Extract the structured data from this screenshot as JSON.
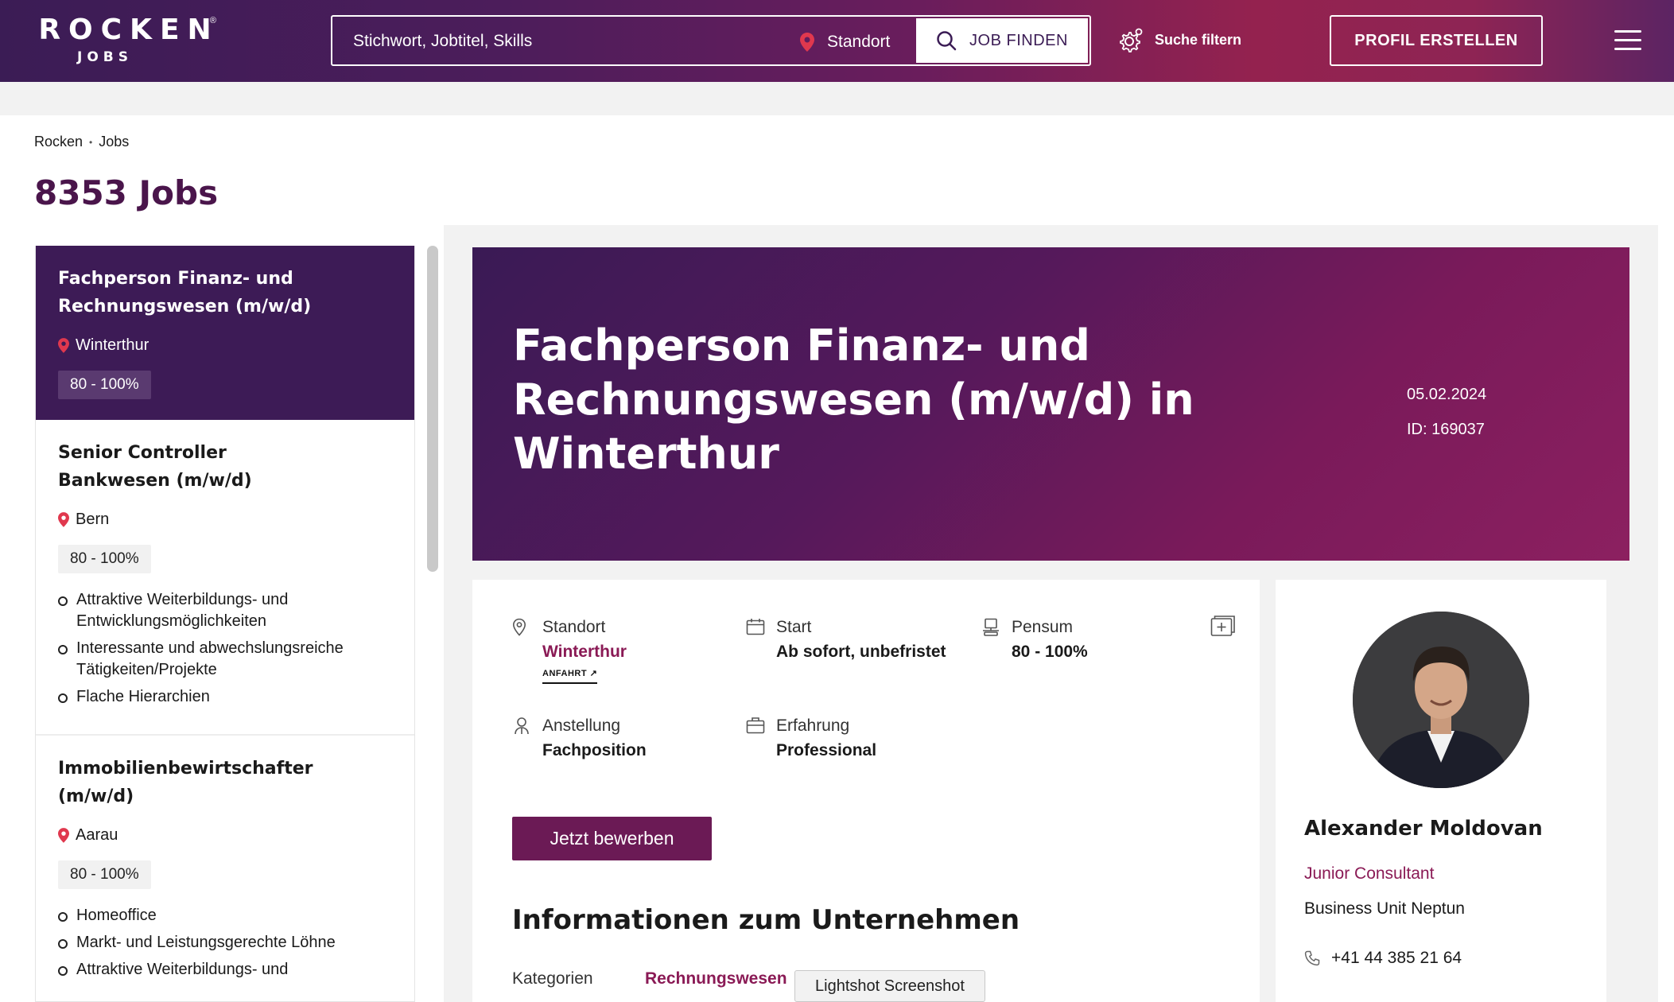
{
  "header": {
    "logo_main": "ROCKEN",
    "logo_sub": "JOBS",
    "logo_reg": "®",
    "search_placeholder": "Stichwort, Jobtitel, Skills",
    "location_label": "Standort",
    "find_button": "JOB FINDEN",
    "filter_label": "Suche filtern",
    "profile_button": "PROFIL ERSTELLEN"
  },
  "breadcrumb": {
    "home": "Rocken",
    "separator": "•",
    "current": "Jobs"
  },
  "page_title": "8353 Jobs",
  "jobs": [
    {
      "title": "Fachperson Finanz- und Rechnungswesen (m/w/d)",
      "location": "Winterthur",
      "pensum": "80 - 100%",
      "bullets": []
    },
    {
      "title": "Senior Controller Bankwesen (m/w/d)",
      "location": "Bern",
      "pensum": "80 - 100%",
      "bullets": [
        "Attraktive Weiterbildungs- und Entwicklungsmöglichkeiten",
        "Interessante und abwechslungsreiche Tätigkeiten/Projekte",
        "Flache Hierarchien"
      ]
    },
    {
      "title": "Immobilienbewirtschafter (m/w/d)",
      "location": "Aarau",
      "pensum": "80 - 100%",
      "bullets": [
        "Homeoffice",
        "Markt- und Leistungsgerechte Löhne",
        "Attraktive Weiterbildungs- und"
      ]
    }
  ],
  "detail": {
    "title": "Fachperson Finanz- und Rechnungswesen (m/w/d) in Winterthur",
    "date": "05.02.2024",
    "id": "ID: 169037",
    "standort_label": "Standort",
    "standort_value": "Winterthur",
    "anfahrt": "ANFAHRT ↗",
    "start_label": "Start",
    "start_value": "Ab sofort, unbefristet",
    "pensum_label": "Pensum",
    "pensum_value": "80 - 100%",
    "anstellung_label": "Anstellung",
    "anstellung_value": "Fachposition",
    "erfahrung_label": "Erfahrung",
    "erfahrung_value": "Professional",
    "apply_button": "Jetzt bewerben",
    "company_section_title": "Informationen zum Unternehmen",
    "kategorien_label": "Kategorien",
    "kategorien_value": "Rechnungswesen"
  },
  "contact": {
    "name": "Alexander Moldovan",
    "role": "Junior Consultant",
    "unit": "Business Unit  Neptun",
    "phone": "+41 44 385 21 64"
  },
  "tooltip": "Lightshot Screenshot",
  "colors": {
    "brand_dark": "#3d1b56",
    "brand_accent": "#8a1a55",
    "apply_button": "#6b1a55",
    "pin_red": "#e0384e"
  },
  "icons": [
    "location-pin-icon",
    "search-icon",
    "gear-icon",
    "menu-icon",
    "calendar-icon",
    "pensum-icon",
    "anstellung-icon",
    "briefcase-icon",
    "calendar-add-icon",
    "phone-icon"
  ]
}
